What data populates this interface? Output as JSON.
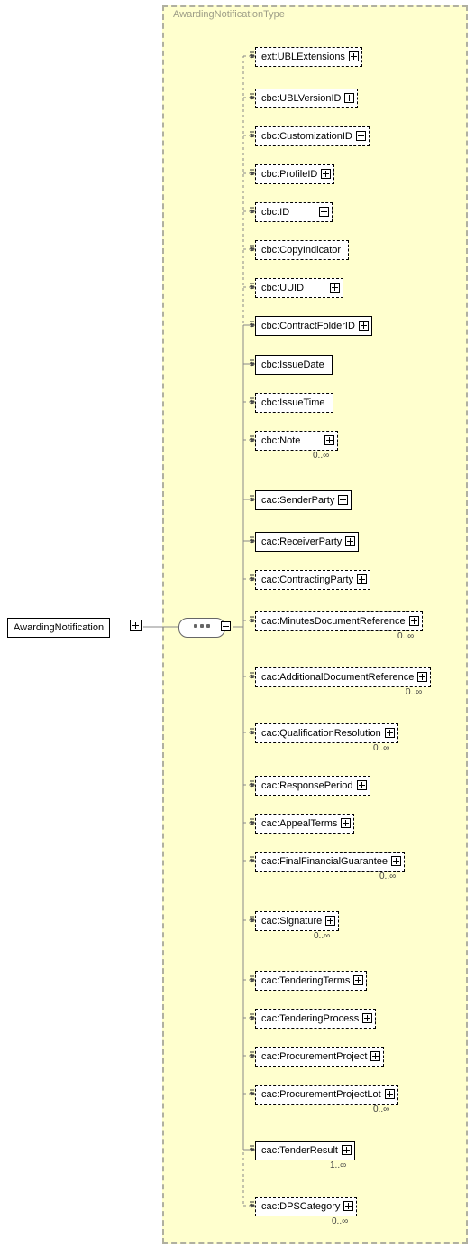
{
  "type_label": "AwardingNotificationType",
  "root": {
    "label": "AwardingNotification"
  },
  "elements": [
    {
      "id": "e0",
      "label": "ext:UBLExtensions",
      "optional": true,
      "expand": true,
      "details": true,
      "card": ""
    },
    {
      "id": "e1",
      "label": "cbc:UBLVersionID",
      "optional": true,
      "expand": true,
      "details": true,
      "card": ""
    },
    {
      "id": "e2",
      "label": "cbc:CustomizationID",
      "optional": true,
      "expand": true,
      "details": true,
      "card": ""
    },
    {
      "id": "e3",
      "label": "cbc:ProfileID",
      "optional": true,
      "expand": true,
      "details": true,
      "card": ""
    },
    {
      "id": "e4",
      "label": "cbc:ID",
      "optional": true,
      "expand": true,
      "details": true,
      "card": "",
      "minw": 60
    },
    {
      "id": "e5",
      "label": "cbc:CopyIndicator",
      "optional": true,
      "expand": false,
      "details": true,
      "card": ""
    },
    {
      "id": "e6",
      "label": "cbc:UUID",
      "optional": true,
      "expand": true,
      "details": true,
      "card": "",
      "minw": 72
    },
    {
      "id": "e7",
      "label": "cbc:ContractFolderID",
      "optional": false,
      "expand": true,
      "details": true,
      "card": ""
    },
    {
      "id": "e8",
      "label": "cbc:IssueDate",
      "optional": false,
      "expand": false,
      "details": true,
      "card": ""
    },
    {
      "id": "e9",
      "label": "cbc:IssueTime",
      "optional": true,
      "expand": false,
      "details": true,
      "card": ""
    },
    {
      "id": "e10",
      "label": "cbc:Note",
      "optional": true,
      "expand": true,
      "details": true,
      "card": "0..∞",
      "minw": 66
    },
    {
      "id": "e11",
      "label": "cac:SenderParty",
      "optional": false,
      "expand": true,
      "details": true,
      "card": ""
    },
    {
      "id": "e12",
      "label": "cac:ReceiverParty",
      "optional": false,
      "expand": true,
      "details": true,
      "card": ""
    },
    {
      "id": "e13",
      "label": "cac:ContractingParty",
      "optional": true,
      "expand": true,
      "details": true,
      "card": ""
    },
    {
      "id": "e14",
      "label": "cac:MinutesDocumentReference",
      "optional": true,
      "expand": true,
      "details": true,
      "card": "0..∞"
    },
    {
      "id": "e15",
      "label": "cac:AdditionalDocumentReference",
      "optional": true,
      "expand": true,
      "details": true,
      "card": "0..∞"
    },
    {
      "id": "e16",
      "label": "cac:QualificationResolution",
      "optional": true,
      "expand": true,
      "details": true,
      "card": "0..∞"
    },
    {
      "id": "e17",
      "label": "cac:ResponsePeriod",
      "optional": true,
      "expand": true,
      "details": true,
      "card": ""
    },
    {
      "id": "e18",
      "label": "cac:AppealTerms",
      "optional": true,
      "expand": true,
      "details": true,
      "card": ""
    },
    {
      "id": "e19",
      "label": "cac:FinalFinancialGuarantee",
      "optional": true,
      "expand": true,
      "details": true,
      "card": "0..∞"
    },
    {
      "id": "e20",
      "label": "cac:Signature",
      "optional": true,
      "expand": true,
      "details": true,
      "card": "0..∞"
    },
    {
      "id": "e21",
      "label": "cac:TenderingTerms",
      "optional": true,
      "expand": true,
      "details": true,
      "card": ""
    },
    {
      "id": "e22",
      "label": "cac:TenderingProcess",
      "optional": true,
      "expand": true,
      "details": true,
      "card": ""
    },
    {
      "id": "e23",
      "label": "cac:ProcurementProject",
      "optional": true,
      "expand": true,
      "details": true,
      "card": ""
    },
    {
      "id": "e24",
      "label": "cac:ProcurementProjectLot",
      "optional": true,
      "expand": true,
      "details": true,
      "card": "0..∞"
    },
    {
      "id": "e25",
      "label": "cac:TenderResult",
      "optional": false,
      "expand": true,
      "details": true,
      "card": "1..∞"
    },
    {
      "id": "e26",
      "label": "cac:DPSCategory",
      "optional": true,
      "expand": true,
      "details": true,
      "card": "0..∞"
    }
  ],
  "chart_data": {
    "type": "area",
    "title": "XML Schema: AwardingNotification (AwardingNotificationType)",
    "root": "AwardingNotification",
    "complex_type": "AwardingNotificationType",
    "compositor": "sequence",
    "children": [
      {
        "name": "ext:UBLExtensions",
        "min": 0,
        "max": 1
      },
      {
        "name": "cbc:UBLVersionID",
        "min": 0,
        "max": 1
      },
      {
        "name": "cbc:CustomizationID",
        "min": 0,
        "max": 1
      },
      {
        "name": "cbc:ProfileID",
        "min": 0,
        "max": 1
      },
      {
        "name": "cbc:ID",
        "min": 0,
        "max": 1
      },
      {
        "name": "cbc:CopyIndicator",
        "min": 0,
        "max": 1
      },
      {
        "name": "cbc:UUID",
        "min": 0,
        "max": 1
      },
      {
        "name": "cbc:ContractFolderID",
        "min": 1,
        "max": 1
      },
      {
        "name": "cbc:IssueDate",
        "min": 1,
        "max": 1
      },
      {
        "name": "cbc:IssueTime",
        "min": 0,
        "max": 1
      },
      {
        "name": "cbc:Note",
        "min": 0,
        "max": "unbounded"
      },
      {
        "name": "cac:SenderParty",
        "min": 1,
        "max": 1
      },
      {
        "name": "cac:ReceiverParty",
        "min": 1,
        "max": 1
      },
      {
        "name": "cac:ContractingParty",
        "min": 0,
        "max": 1
      },
      {
        "name": "cac:MinutesDocumentReference",
        "min": 0,
        "max": "unbounded"
      },
      {
        "name": "cac:AdditionalDocumentReference",
        "min": 0,
        "max": "unbounded"
      },
      {
        "name": "cac:QualificationResolution",
        "min": 0,
        "max": "unbounded"
      },
      {
        "name": "cac:ResponsePeriod",
        "min": 0,
        "max": 1
      },
      {
        "name": "cac:AppealTerms",
        "min": 0,
        "max": 1
      },
      {
        "name": "cac:FinalFinancialGuarantee",
        "min": 0,
        "max": "unbounded"
      },
      {
        "name": "cac:Signature",
        "min": 0,
        "max": "unbounded"
      },
      {
        "name": "cac:TenderingTerms",
        "min": 0,
        "max": 1
      },
      {
        "name": "cac:TenderingProcess",
        "min": 0,
        "max": 1
      },
      {
        "name": "cac:ProcurementProject",
        "min": 0,
        "max": 1
      },
      {
        "name": "cac:ProcurementProjectLot",
        "min": 0,
        "max": "unbounded"
      },
      {
        "name": "cac:TenderResult",
        "min": 1,
        "max": "unbounded"
      },
      {
        "name": "cac:DPSCategory",
        "min": 0,
        "max": "unbounded"
      }
    ]
  }
}
